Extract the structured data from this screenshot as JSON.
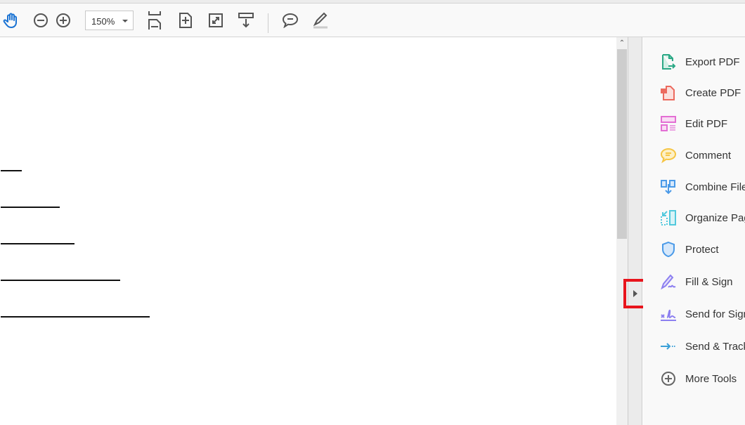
{
  "toolbar": {
    "zoom_value": "150%",
    "icons": [
      "hand-icon",
      "zoom-out-icon",
      "zoom-in-icon",
      "fit-width-icon",
      "fit-page-icon",
      "full-screen-icon",
      "scroll-mode-icon",
      "comment-icon",
      "highlight-icon"
    ]
  },
  "document": {
    "underline_count": 5
  },
  "panel": {
    "tools": [
      {
        "label": "Export PDF",
        "icon": "export-pdf-icon",
        "color": "#2aa885"
      },
      {
        "label": "Create PDF",
        "icon": "create-pdf-icon",
        "color": "#ec6a5e"
      },
      {
        "label": "Edit PDF",
        "icon": "edit-pdf-icon",
        "color": "#e36fd4"
      },
      {
        "label": "Comment",
        "icon": "comment-icon",
        "color": "#f6c544"
      },
      {
        "label": "Combine Files",
        "icon": "combine-files-icon",
        "color": "#4a9ae8"
      },
      {
        "label": "Organize Pages",
        "icon": "organize-pages-icon",
        "color": "#52c9dd"
      },
      {
        "label": "Protect",
        "icon": "protect-icon",
        "color": "#4a9ae8"
      },
      {
        "label": "Fill & Sign",
        "icon": "fill-sign-icon",
        "color": "#8c7ff0"
      },
      {
        "label": "Send for Signature",
        "icon": "send-for-signature-icon",
        "color": "#8c7ff0"
      },
      {
        "label": "Send & Track",
        "icon": "send-track-icon",
        "color": "#3aa0d8"
      },
      {
        "label": "More Tools",
        "icon": "more-tools-icon",
        "color": "#666666"
      }
    ]
  },
  "highlight_color": "#e8141c"
}
